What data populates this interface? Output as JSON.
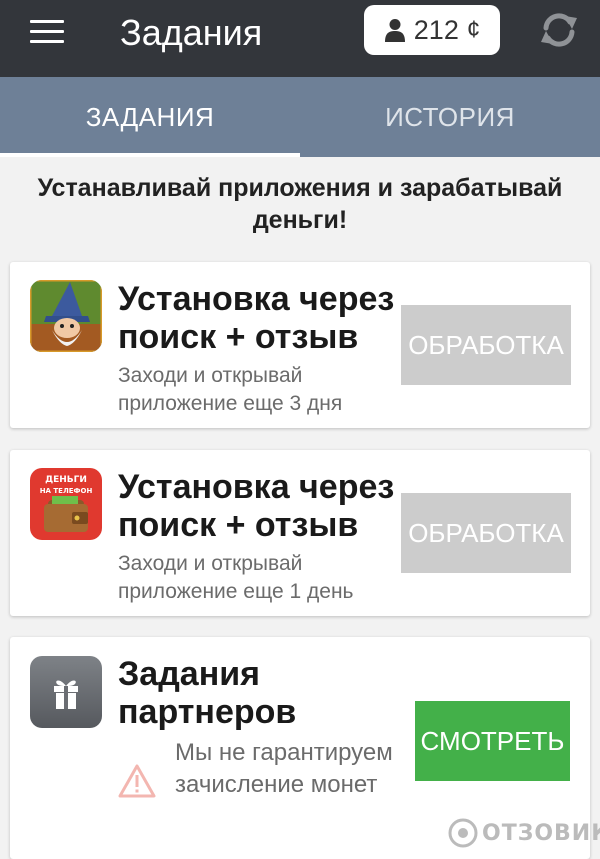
{
  "header": {
    "title": "Задания",
    "balance": "212",
    "currency": "¢"
  },
  "tabs": [
    {
      "label": "ЗАДАНИЯ",
      "active": true
    },
    {
      "label": "ИСТОРИЯ",
      "active": false
    }
  ],
  "headline": "Устанавливай приложения и зарабатывай деньги!",
  "tasks": [
    {
      "title": "Установка через поиск + отзыв",
      "subtitle": "Заходи и открывай приложение еще 3 дня",
      "button": "ОБРАБОТКА",
      "icon": "wizard-game-icon"
    },
    {
      "title": "Установка через поиск + отзыв",
      "subtitle": "Заходи и открывай приложение еще 1 день",
      "button": "ОБРАБОТКА",
      "icon": "money-wallet-app-icon",
      "icon_label": "ДЕНЬГИ НА ТЕЛЕФОН"
    }
  ],
  "partners": {
    "title": "Задания партнеров",
    "warning": "Мы не гарантируем зачисление монет",
    "button": "СМОТРЕТЬ",
    "icon": "gift-icon"
  },
  "watermark": "ОТЗОВИК",
  "colors": {
    "appbar": "#33363b",
    "tabs": "#6e8097",
    "processing_button": "#cccccc",
    "watch_button": "#43b049"
  }
}
